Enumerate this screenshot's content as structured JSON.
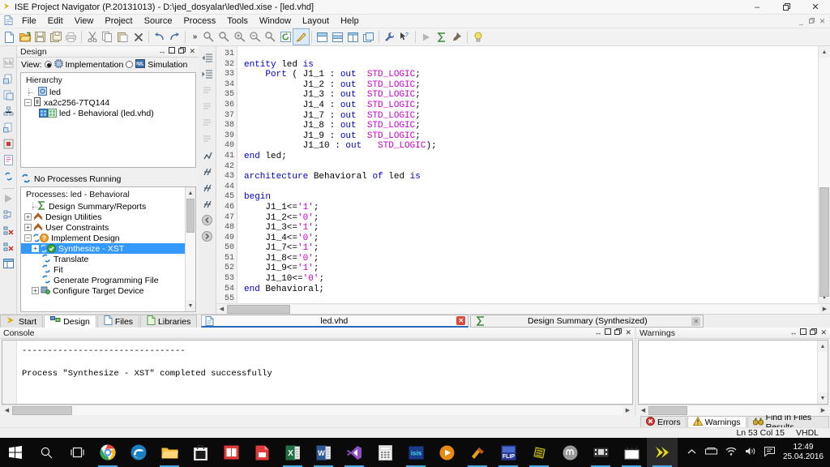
{
  "window": {
    "title": "ISE Project Navigator (P.20131013) - D:\\jed_dosyalar\\led\\led.xise - [led.vhd]",
    "app_icon": "ise-arrow-icon",
    "minimize": "–",
    "maximize": "❐",
    "close": "✕",
    "doc_minimize": "_",
    "doc_restore": "❐",
    "doc_close": "✕"
  },
  "menu": {
    "icon": "document-icon",
    "items": [
      "File",
      "Edit",
      "View",
      "Project",
      "Source",
      "Process",
      "Tools",
      "Window",
      "Layout",
      "Help"
    ]
  },
  "toolbar": {
    "overflow": "»",
    "groups": [
      [
        "new-file-icon",
        "open-project-icon",
        "save-icon",
        "save-all-icon",
        "print-icon"
      ],
      [
        "cut-icon",
        "copy-icon",
        "paste-icon",
        "delete-icon",
        "undo-icon",
        "redo-icon"
      ],
      [
        "find-icon",
        "find-next-icon",
        "zoom-in-icon",
        "zoom-out-icon",
        "find-key-icon",
        "refresh-icon",
        "highlight-icon"
      ],
      [
        "panel-top-icon",
        "panel-split-icon",
        "panel-columns-icon",
        "panel-float-icon"
      ],
      [
        "wrench-icon",
        "help-pointer-icon"
      ],
      [
        "run-icon",
        "sigma-icon",
        "pin-icon"
      ],
      [
        "bulb-icon"
      ]
    ]
  },
  "design_panel": {
    "title": "Design",
    "controls": [
      "↔",
      "❐",
      "❐",
      "✕"
    ],
    "view_label": "View:",
    "view_options": [
      {
        "label": "Implementation",
        "selected": true,
        "icon": "chip-icon"
      },
      {
        "label": "Simulation",
        "selected": false,
        "icon": "waveform-icon"
      }
    ],
    "hierarchy_label": "Hierarchy",
    "tree": [
      {
        "label": "led",
        "indent": 1,
        "icon": "project-icon",
        "expander": "",
        "selected": false
      },
      {
        "label": "xa2c256-7TQ144",
        "indent": 0,
        "icon": "device-icon",
        "expander": "−",
        "selected": false
      },
      {
        "label": "led - Behavioral (led.vhd)",
        "indent": 2,
        "icon": "vhdl-module-icon",
        "expander": "",
        "selected": false
      }
    ]
  },
  "process_panel": {
    "status": "No Processes Running",
    "status_icon": "processes-icon",
    "header": "Processes: led - Behavioral",
    "items": [
      {
        "label": "Design Summary/Reports",
        "indent": 1,
        "expander": "",
        "icon": "sigma-green-icon",
        "selected": false
      },
      {
        "label": "Design Utilities",
        "indent": 0,
        "expander": "+",
        "icon": "utilities-icon",
        "selected": false
      },
      {
        "label": "User Constraints",
        "indent": 0,
        "expander": "+",
        "icon": "constraints-icon",
        "selected": false
      },
      {
        "label": "Implement Design",
        "indent": 0,
        "expander": "−",
        "icon": "implement-warn-icon",
        "selected": false
      },
      {
        "label": "Synthesize - XST",
        "indent": 1,
        "expander": "+",
        "icon": "check-green-icon",
        "selected": true
      },
      {
        "label": "Translate",
        "indent": 2,
        "expander": "",
        "icon": "process-icon",
        "selected": false
      },
      {
        "label": "Fit",
        "indent": 2,
        "expander": "",
        "icon": "process-icon",
        "selected": false
      },
      {
        "label": "Generate Programming File",
        "indent": 2,
        "expander": "",
        "icon": "process-icon",
        "selected": false
      },
      {
        "label": "Configure Target Device",
        "indent": 1,
        "expander": "+",
        "icon": "configure-icon",
        "selected": false
      }
    ]
  },
  "editor": {
    "first_line": 31,
    "lines": [
      {
        "n": 31,
        "tokens": []
      },
      {
        "n": 32,
        "tokens": [
          {
            "t": "entity",
            "c": "kw"
          },
          {
            "t": " led ",
            "c": ""
          },
          {
            "t": "is",
            "c": "kw"
          }
        ]
      },
      {
        "n": 33,
        "tokens": [
          {
            "t": "    ",
            "c": ""
          },
          {
            "t": "Port",
            "c": "kw"
          },
          {
            "t": " ( J1_1 : ",
            "c": ""
          },
          {
            "t": "out",
            "c": "kw"
          },
          {
            "t": "  ",
            "c": ""
          },
          {
            "t": "STD_LOGIC",
            "c": "ty"
          },
          {
            "t": ";",
            "c": ""
          }
        ]
      },
      {
        "n": 34,
        "tokens": [
          {
            "t": "           J1_2 : ",
            "c": ""
          },
          {
            "t": "out",
            "c": "kw"
          },
          {
            "t": "  ",
            "c": ""
          },
          {
            "t": "STD_LOGIC",
            "c": "ty"
          },
          {
            "t": ";",
            "c": ""
          }
        ]
      },
      {
        "n": 35,
        "tokens": [
          {
            "t": "           J1_3 : ",
            "c": ""
          },
          {
            "t": "out",
            "c": "kw"
          },
          {
            "t": "  ",
            "c": ""
          },
          {
            "t": "STD_LOGIC",
            "c": "ty"
          },
          {
            "t": ";",
            "c": ""
          }
        ]
      },
      {
        "n": 36,
        "tokens": [
          {
            "t": "           J1_4 : ",
            "c": ""
          },
          {
            "t": "out",
            "c": "kw"
          },
          {
            "t": "  ",
            "c": ""
          },
          {
            "t": "STD_LOGIC",
            "c": "ty"
          },
          {
            "t": ";",
            "c": ""
          }
        ]
      },
      {
        "n": 37,
        "tokens": [
          {
            "t": "           J1_7 : ",
            "c": ""
          },
          {
            "t": "out",
            "c": "kw"
          },
          {
            "t": "  ",
            "c": ""
          },
          {
            "t": "STD_LOGIC",
            "c": "ty"
          },
          {
            "t": ";",
            "c": ""
          }
        ]
      },
      {
        "n": 38,
        "tokens": [
          {
            "t": "           J1_8 : ",
            "c": ""
          },
          {
            "t": "out",
            "c": "kw"
          },
          {
            "t": "  ",
            "c": ""
          },
          {
            "t": "STD_LOGIC",
            "c": "ty"
          },
          {
            "t": ";",
            "c": ""
          }
        ]
      },
      {
        "n": 39,
        "tokens": [
          {
            "t": "           J1_9 : ",
            "c": ""
          },
          {
            "t": "out",
            "c": "kw"
          },
          {
            "t": "  ",
            "c": ""
          },
          {
            "t": "STD_LOGIC",
            "c": "ty"
          },
          {
            "t": ";",
            "c": ""
          }
        ]
      },
      {
        "n": 40,
        "tokens": [
          {
            "t": "           J1_10 : ",
            "c": ""
          },
          {
            "t": "out",
            "c": "kw"
          },
          {
            "t": "   ",
            "c": ""
          },
          {
            "t": "STD_LOGIC",
            "c": "ty"
          },
          {
            "t": ");",
            "c": ""
          }
        ]
      },
      {
        "n": 41,
        "tokens": [
          {
            "t": "end",
            "c": "kw"
          },
          {
            "t": " led;",
            "c": ""
          }
        ]
      },
      {
        "n": 42,
        "tokens": []
      },
      {
        "n": 43,
        "tokens": [
          {
            "t": "architecture",
            "c": "kw"
          },
          {
            "t": " Behavioral ",
            "c": ""
          },
          {
            "t": "of",
            "c": "kw"
          },
          {
            "t": " led ",
            "c": ""
          },
          {
            "t": "is",
            "c": "kw"
          }
        ]
      },
      {
        "n": 44,
        "tokens": []
      },
      {
        "n": 45,
        "tokens": [
          {
            "t": "begin",
            "c": "kw"
          }
        ]
      },
      {
        "n": 46,
        "tokens": [
          {
            "t": "    J1_1<=",
            "c": ""
          },
          {
            "t": "'1'",
            "c": "str"
          },
          {
            "t": ";",
            "c": ""
          }
        ]
      },
      {
        "n": 47,
        "tokens": [
          {
            "t": "    J1_2<=",
            "c": ""
          },
          {
            "t": "'0'",
            "c": "str"
          },
          {
            "t": ";",
            "c": ""
          }
        ]
      },
      {
        "n": 48,
        "tokens": [
          {
            "t": "    J1_3<=",
            "c": ""
          },
          {
            "t": "'1'",
            "c": "str"
          },
          {
            "t": ";",
            "c": ""
          }
        ]
      },
      {
        "n": 49,
        "tokens": [
          {
            "t": "    J1_4<=",
            "c": ""
          },
          {
            "t": "'0'",
            "c": "str"
          },
          {
            "t": ";",
            "c": ""
          }
        ]
      },
      {
        "n": 50,
        "tokens": [
          {
            "t": "    J1_7<=",
            "c": ""
          },
          {
            "t": "'1'",
            "c": "str"
          },
          {
            "t": ";",
            "c": ""
          }
        ]
      },
      {
        "n": 51,
        "tokens": [
          {
            "t": "    J1_8<=",
            "c": ""
          },
          {
            "t": "'0'",
            "c": "str"
          },
          {
            "t": ";",
            "c": ""
          }
        ]
      },
      {
        "n": 52,
        "tokens": [
          {
            "t": "    J1_9<=",
            "c": ""
          },
          {
            "t": "'1'",
            "c": "str"
          },
          {
            "t": ";",
            "c": ""
          }
        ]
      },
      {
        "n": 53,
        "tokens": [
          {
            "t": "    J1_10<=",
            "c": ""
          },
          {
            "t": "'0'",
            "c": "str"
          },
          {
            "t": ";",
            "c": ""
          }
        ]
      },
      {
        "n": 54,
        "tokens": [
          {
            "t": "end",
            "c": "kw"
          },
          {
            "t": " Behavioral;",
            "c": ""
          }
        ]
      },
      {
        "n": 55,
        "tokens": []
      }
    ]
  },
  "tabstrip": {
    "view_tabs": [
      {
        "label": "Start",
        "icon": "start-arrow-icon",
        "active": false
      },
      {
        "label": "Design",
        "icon": "design-icon",
        "active": true
      },
      {
        "label": "Files",
        "icon": "files-icon",
        "active": false
      },
      {
        "label": "Libraries",
        "icon": "libraries-icon",
        "active": false
      }
    ],
    "doc_tabs": [
      {
        "label": "led.vhd",
        "icon": "vhdl-file-icon",
        "active": true,
        "close": "✕"
      },
      {
        "label": "Design Summary (Synthesized)",
        "icon": "sigma-green-icon",
        "active": false,
        "close": "✕"
      }
    ]
  },
  "console": {
    "title": "Console",
    "controls": [
      "↔",
      "❐",
      "❐",
      "✕"
    ],
    "text": "--------------------------------\n\nProcess \"Synthesize - XST\" completed successfully"
  },
  "warnings": {
    "title": "Warnings",
    "controls": [
      "↔",
      "❐",
      "❐",
      "✕"
    ],
    "text": ""
  },
  "status_tabs": [
    {
      "label": "Errors",
      "icon": "error-icon",
      "active": false
    },
    {
      "label": "Warnings",
      "icon": "warning-icon",
      "active": true
    },
    {
      "label": "Find in Files Results",
      "icon": "binoculars-icon",
      "active": false
    }
  ],
  "statusbar": {
    "position": "Ln 53 Col 15",
    "language": "VHDL"
  },
  "taskbar": {
    "start_icon": "windows-start-icon",
    "search_icon": "search-icon",
    "taskview_icon": "task-view-icon",
    "apps": [
      {
        "name": "chrome-icon",
        "running": true
      },
      {
        "name": "edge-icon",
        "running": false
      },
      {
        "name": "file-explorer-icon",
        "running": true
      },
      {
        "name": "store-icon",
        "running": false
      },
      {
        "name": "reader-icon",
        "running": false
      },
      {
        "name": "pdf-icon",
        "running": false
      },
      {
        "name": "excel-icon",
        "running": true
      },
      {
        "name": "word-icon",
        "running": true
      },
      {
        "name": "visual-studio-icon",
        "running": true
      },
      {
        "name": "calculator-icon",
        "running": false
      },
      {
        "name": "isis-icon",
        "running": true
      },
      {
        "name": "media-player-icon",
        "running": false
      },
      {
        "name": "ares-icon",
        "running": true
      },
      {
        "name": "flip-icon",
        "running": true
      },
      {
        "name": "chip-designer-icon",
        "running": true
      },
      {
        "name": "moodle-icon",
        "running": false
      },
      {
        "name": "video-editor-icon",
        "running": true
      },
      {
        "name": "movie-maker-icon",
        "running": true
      },
      {
        "name": "ise-navigator-icon",
        "running": true,
        "active": true
      }
    ],
    "tray": [
      "chevron-up-icon",
      "removable-drive-icon",
      "network-icon",
      "volume-icon",
      "action-center-icon"
    ],
    "time": "12:49",
    "date": "25.04.2016"
  },
  "colors": {
    "selection": "#3399ff",
    "keyword": "#0000c8",
    "type": "#cc00cc",
    "accent": "#2a6bbf",
    "taskbar": "#0a0a0a"
  }
}
